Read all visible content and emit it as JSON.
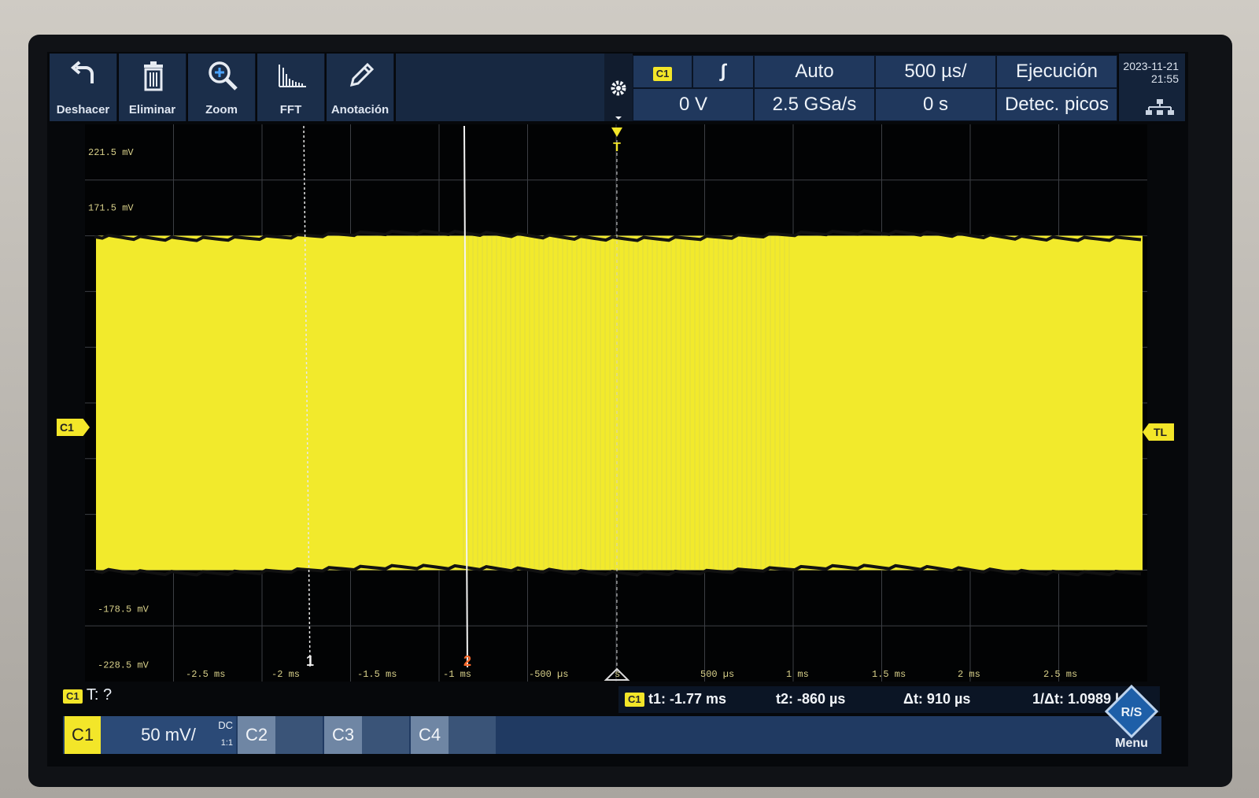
{
  "toolbar": {
    "tools": [
      {
        "label": "Deshacer",
        "icon": "undo-icon"
      },
      {
        "label": "Eliminar",
        "icon": "trash-icon"
      },
      {
        "label": "Zoom",
        "icon": "zoom-icon"
      },
      {
        "label": "FFT",
        "icon": "fft-icon"
      },
      {
        "label": "Anotación",
        "icon": "pencil-icon"
      }
    ]
  },
  "status": {
    "trigger_source": "C1",
    "trigger_slope": "∫",
    "trigger_mode": "Auto",
    "timebase": "500 µs/",
    "run_state": "Ejecución",
    "trigger_level": "0 V",
    "sample_rate": "2.5 GSa/s",
    "time_offset": "0 s",
    "acquisition": "Detec. picos",
    "date": "2023-11-21",
    "time": "21:55"
  },
  "plot": {
    "y_labels": [
      "221.5 mV",
      "171.5 mV",
      "-178.5 mV",
      "-228.5 mV"
    ],
    "x_labels": [
      "-2.5 ms",
      "-2 ms",
      "-1.5 ms",
      "-1 ms",
      "-500 µs",
      "s",
      "500 µs",
      "1 ms",
      "1.5 ms",
      "2 ms",
      "2.5 ms"
    ],
    "channel_marker": "C1",
    "trigger_level_marker": "TL",
    "trigger_pos_marker": "T",
    "cursor1": "1",
    "cursor2": "2",
    "signal_color": "#f2ea2c",
    "envelope_top_mv": 150,
    "envelope_bottom_mv": -150,
    "volts_per_div": 50,
    "time_per_div_us": 500
  },
  "trigger_info": {
    "badge": "C1",
    "text": "T: ?"
  },
  "cursors": {
    "badge": "C1",
    "t1": "t1: -1.77 ms",
    "t2": "t2: -860 µs",
    "dt": "Δt: 910 µs",
    "inv_dt": "1/Δt: 1.0989 kH"
  },
  "channels": {
    "c1": {
      "name": "C1",
      "scale": "50 mV/",
      "coupling": "DC",
      "ratio": "1:1"
    },
    "c2": {
      "name": "C2"
    },
    "c3": {
      "name": "C3"
    },
    "c4": {
      "name": "C4"
    }
  },
  "menu": {
    "label": "Menu",
    "logo": "R/S"
  },
  "colors": {
    "accent": "#20385d",
    "channel1": "#f3e629",
    "cursor2": "#ff6a2a"
  }
}
